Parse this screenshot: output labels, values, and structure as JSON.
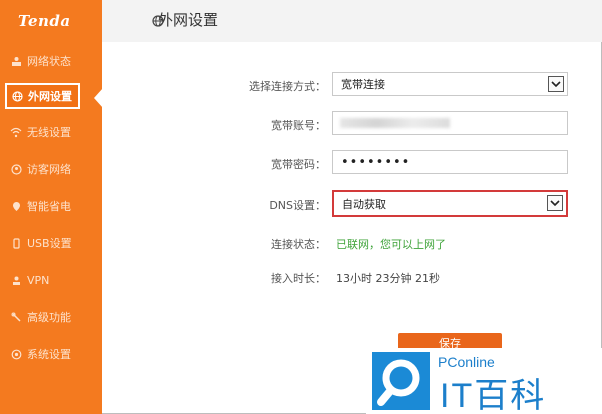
{
  "app": {
    "logo": "Tenda",
    "page_title": "外网设置"
  },
  "sidebar": {
    "items": [
      {
        "label": "网络状态",
        "icon": "network-status-icon",
        "active": false
      },
      {
        "label": "外网设置",
        "icon": "globe-icon",
        "active": true
      },
      {
        "label": "无线设置",
        "icon": "wifi-icon",
        "active": false
      },
      {
        "label": "访客网络",
        "icon": "guest-network-icon",
        "active": false
      },
      {
        "label": "智能省电",
        "icon": "power-saving-icon",
        "active": false
      },
      {
        "label": "USB设置",
        "icon": "usb-icon",
        "active": false
      },
      {
        "label": "VPN",
        "icon": "vpn-icon",
        "active": false
      },
      {
        "label": "高级功能",
        "icon": "wrench-icon",
        "active": false
      },
      {
        "label": "系统设置",
        "icon": "gear-icon",
        "active": false
      }
    ]
  },
  "form": {
    "connection_type_label": "选择连接方式：",
    "connection_type_value": "宽带连接",
    "account_label": "宽带账号：",
    "password_label": "宽带密码：",
    "password_value": "••••••••",
    "dns_label": "DNS设置：",
    "dns_value": "自动获取",
    "status_label": "连接状态：",
    "status_value": "已联网，您可以上网了",
    "uptime_label": "接入时长：",
    "uptime_value": "13小时 23分钟 21秒",
    "save_label": "保存"
  },
  "watermark": {
    "brand_top": "PConline",
    "brand_main": "IT百科"
  },
  "colors": {
    "sidebar": "#f47a1f",
    "status_ok": "#3fa33a",
    "dns_highlight": "#d33a3a",
    "watermark_blue": "#1c7fcb"
  }
}
